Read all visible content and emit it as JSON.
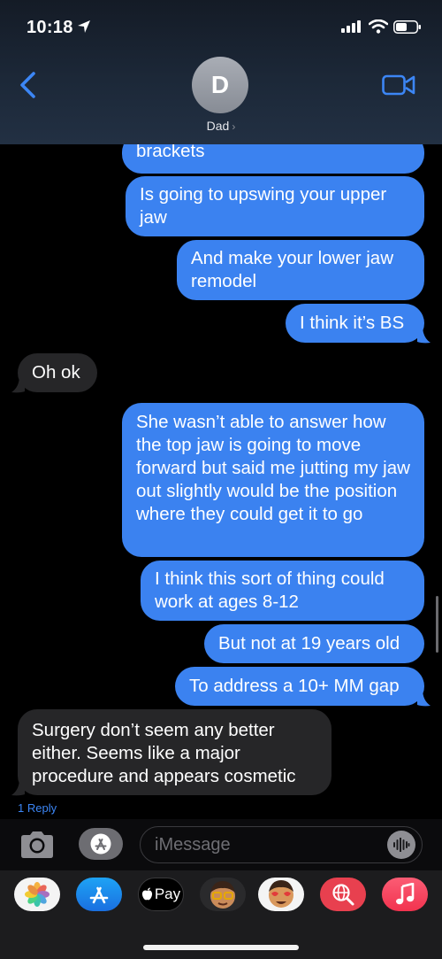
{
  "status_bar": {
    "time": "10:18"
  },
  "header": {
    "avatar_initial": "D",
    "contact_name": "Dad",
    "contact_chevron": "›"
  },
  "messages": [
    {
      "text": "brackets",
      "from": "me"
    },
    {
      "text": "Is going to upswing your upper jaw",
      "from": "me"
    },
    {
      "text": "And make your lower jaw remodel",
      "from": "me"
    },
    {
      "text": "I think it’s BS",
      "from": "me"
    },
    {
      "text": "Oh ok",
      "from": "them"
    },
    {
      "text": "She wasn’t able to answer how the top jaw is going to move forward but said me jutting my jaw out slightly would be the position where they could get it to go",
      "from": "me"
    },
    {
      "text": "I think this sort of thing could work at ages 8-12",
      "from": "me"
    },
    {
      "text": "But not at 19 years old",
      "from": "me"
    },
    {
      "text": "To address a 10+ MM gap",
      "from": "me"
    },
    {
      "text": "Surgery don’t seem any better either. Seems like a major procedure and appears cosmetic",
      "from": "them"
    }
  ],
  "reply_count_label": "1 Reply",
  "composer": {
    "placeholder": "iMessage"
  },
  "app_drawer": {
    "items": [
      {
        "name": "photos",
        "icon": "photos-icon"
      },
      {
        "name": "app-store",
        "icon": "app-store-icon"
      },
      {
        "name": "apple-pay",
        "label": "Pay",
        "icon": "apple-pay-icon"
      },
      {
        "name": "memoji-1",
        "icon": "memoji-icon"
      },
      {
        "name": "memoji-2",
        "icon": "memoji-icon"
      },
      {
        "name": "web-search",
        "icon": "globe-search-icon"
      },
      {
        "name": "music",
        "icon": "music-note-icon"
      }
    ]
  },
  "colors": {
    "sent_bubble": "#3b82f0",
    "received_bubble": "#262628",
    "accent": "#3c86f5"
  }
}
